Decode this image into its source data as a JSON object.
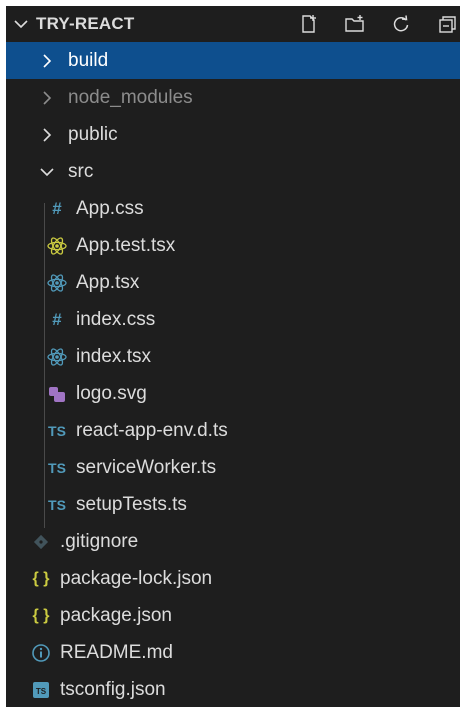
{
  "explorer": {
    "title": "TRY-REACT",
    "actions": [
      "new-file-icon",
      "new-folder-icon",
      "refresh-icon",
      "collapse-all-icon"
    ]
  },
  "tree": {
    "build": "build",
    "node_modules": "node_modules",
    "public": "public",
    "src": "src",
    "src_files": {
      "app_css": "App.css",
      "app_test": "App.test.tsx",
      "app_tsx": "App.tsx",
      "index_css": "index.css",
      "index_tsx": "index.tsx",
      "logo": "logo.svg",
      "react_app_env": "react-app-env.d.ts",
      "service_worker": "serviceWorker.ts",
      "setup_tests": "setupTests.ts"
    },
    "gitignore": ".gitignore",
    "package_lock": "package-lock.json",
    "package": "package.json",
    "readme": "README.md",
    "tsconfig": "tsconfig.json"
  },
  "icon_glyphs": {
    "hash": "#",
    "ts": "TS",
    "json": "{ }"
  },
  "colors": {
    "background": "#1e1e1e",
    "selection": "#0e4f8e",
    "react_yellow": "#cbcb41",
    "react_blue": "#519aba",
    "svg_purple": "#a074c4"
  }
}
